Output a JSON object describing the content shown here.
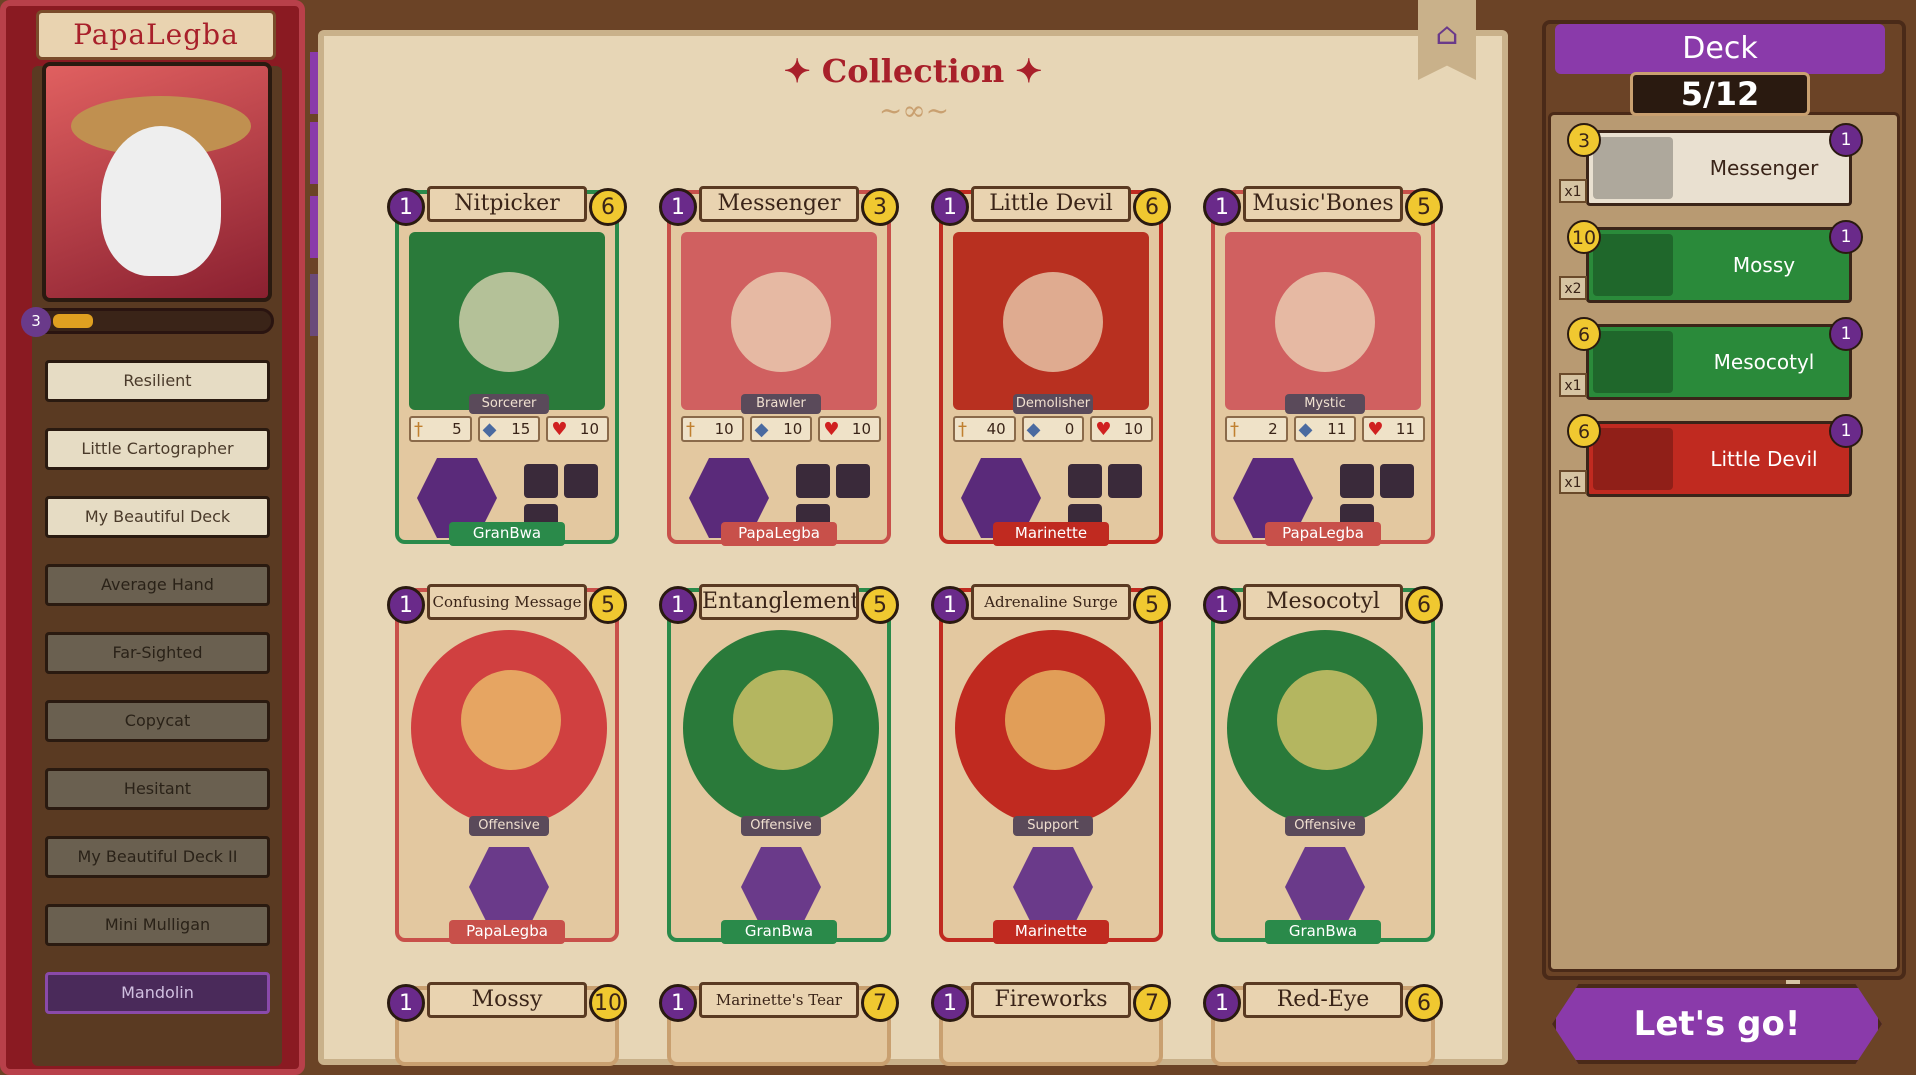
{
  "profile": {
    "name": "PapaLegba",
    "level": "3"
  },
  "presets": [
    {
      "label": "Resilient",
      "state": "lit"
    },
    {
      "label": "Little Cartographer",
      "state": "lit"
    },
    {
      "label": "My Beautiful Deck",
      "state": "lit"
    },
    {
      "label": "Average Hand",
      "state": "dim"
    },
    {
      "label": "Far-Sighted",
      "state": "dim"
    },
    {
      "label": "Copycat",
      "state": "dim"
    },
    {
      "label": "Hesitant",
      "state": "dim"
    },
    {
      "label": "My Beautiful Deck II",
      "state": "dim"
    },
    {
      "label": "Mini Mulligan",
      "state": "dim"
    },
    {
      "label": "Mandolin",
      "state": "sel"
    }
  ],
  "collection": {
    "title": "Collection"
  },
  "cards": [
    {
      "name": "Nitpicker",
      "cost": "1",
      "level": "6",
      "class": "Sorcerer",
      "attack": "5",
      "armor": "15",
      "health": "10",
      "owner": "GranBwa",
      "color": "#2a8a4a",
      "art": "#2a7a3a"
    },
    {
      "name": "Messenger",
      "cost": "1",
      "level": "3",
      "class": "Brawler",
      "attack": "10",
      "armor": "10",
      "health": "10",
      "owner": "PapaLegba",
      "color": "#c8504a",
      "art": "#d06060"
    },
    {
      "name": "Little Devil",
      "cost": "1",
      "level": "6",
      "class": "Demolisher",
      "attack": "40",
      "armor": "0",
      "health": "10",
      "owner": "Marinette",
      "color": "#c02a20",
      "art": "#b83020"
    },
    {
      "name": "Music'Bones",
      "cost": "1",
      "level": "5",
      "class": "Mystic",
      "attack": "2",
      "armor": "11",
      "health": "11",
      "owner": "PapaLegba",
      "color": "#c8504a",
      "art": "#d06060"
    },
    {
      "name": "Confusing Message",
      "cost": "1",
      "level": "5",
      "class": "Offensive",
      "owner": "PapaLegba",
      "color": "#c8504a",
      "art": "#d04040",
      "small": true
    },
    {
      "name": "Entanglement",
      "cost": "1",
      "level": "5",
      "class": "Offensive",
      "owner": "GranBwa",
      "color": "#2a8a4a",
      "art": "#2a7a3a"
    },
    {
      "name": "Adrenaline Surge",
      "cost": "1",
      "level": "5",
      "class": "Support",
      "owner": "Marinette",
      "color": "#c02a20",
      "art": "#c02a20",
      "small": true
    },
    {
      "name": "Mesocotyl",
      "cost": "1",
      "level": "6",
      "class": "Offensive",
      "owner": "GranBwa",
      "color": "#2a8a4a",
      "art": "#2a7a3a"
    },
    {
      "name": "Mossy",
      "cost": "1",
      "level": "10"
    },
    {
      "name": "Marinette's Tear",
      "cost": "1",
      "level": "7",
      "small": true
    },
    {
      "name": "Fireworks",
      "cost": "1",
      "level": "7"
    },
    {
      "name": "Red-Eye",
      "cost": "1",
      "level": "6"
    }
  ],
  "deck": {
    "title": "Deck",
    "count": "5/12",
    "entries": [
      {
        "name": "Messenger",
        "cost": "3",
        "level": "1",
        "qty": "x1",
        "bg": "#e9e0d0",
        "fg": "#3a2418"
      },
      {
        "name": "Mossy",
        "cost": "10",
        "level": "1",
        "qty": "x2",
        "bg": "#2a8a3a",
        "fg": "#ffffff"
      },
      {
        "name": "Mesocotyl",
        "cost": "6",
        "level": "1",
        "qty": "x1",
        "bg": "#2a8a3a",
        "fg": "#ffffff"
      },
      {
        "name": "Little Devil",
        "cost": "6",
        "level": "1",
        "qty": "x1",
        "bg": "#c02a20",
        "fg": "#ffffff"
      }
    ]
  },
  "action": {
    "go": "Let's go!"
  }
}
